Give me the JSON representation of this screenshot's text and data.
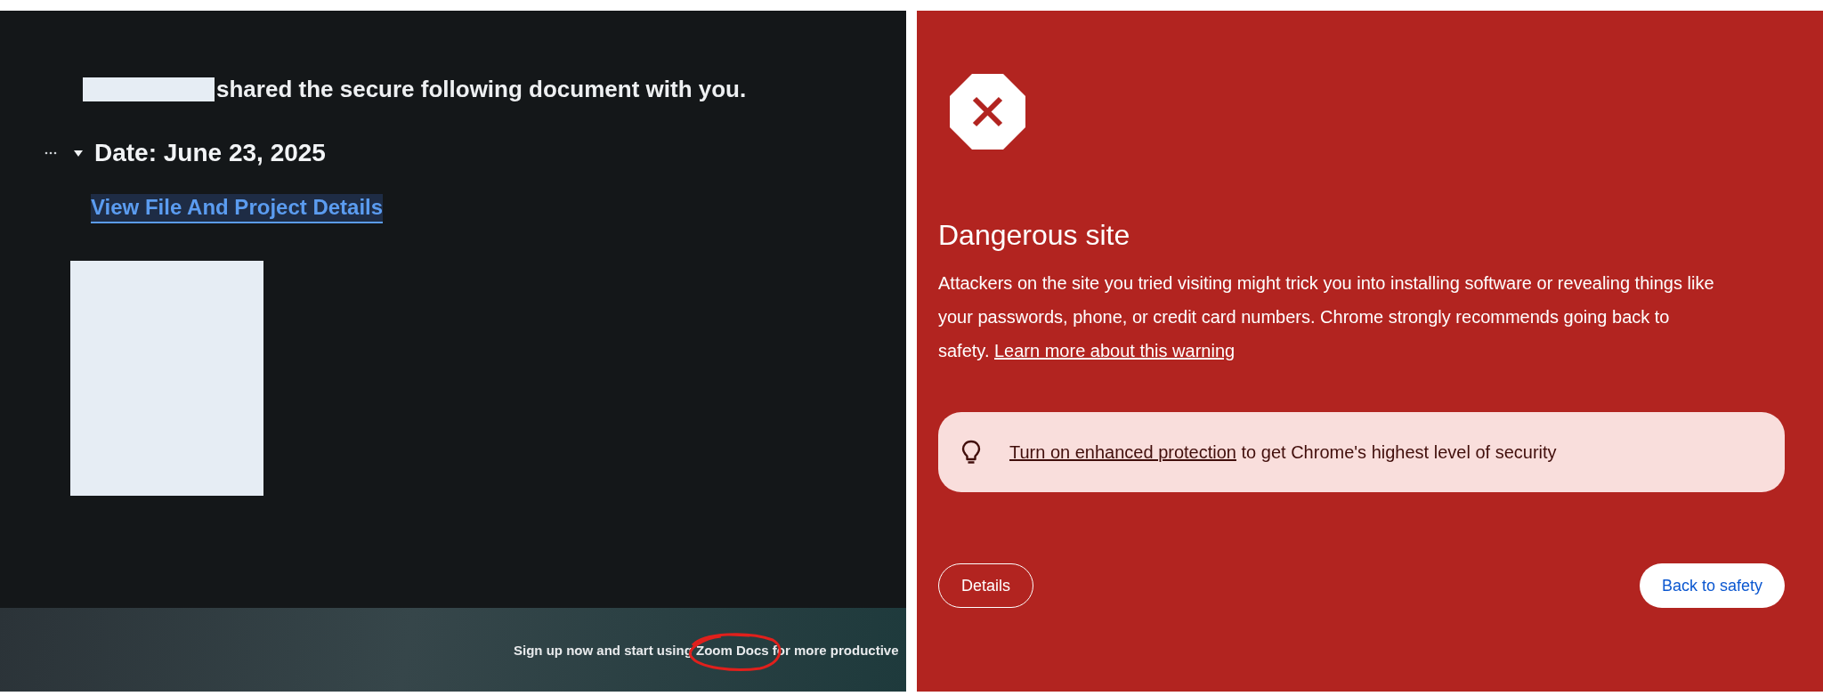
{
  "left": {
    "share_message": "shared the secure following document with you.",
    "section": {
      "title": "Date: June 23, 2025",
      "expanded": true,
      "link": "View File And Project Details"
    },
    "banner": {
      "text": "Sign up now and start using Zoom Docs for more productive"
    }
  },
  "right": {
    "title": "Dangerous site",
    "description": "Attackers on the site you tried visiting might trick you into installing software or revealing things like your passwords, phone, or credit card numbers. Chrome strongly recommends going back to safety. ",
    "learn_more_link": "Learn more about this warning",
    "tip": {
      "link": "Turn on enhanced protection",
      "text": " to get Chrome's highest level of security"
    },
    "buttons": [
      {
        "label": "Details",
        "kind": "outlined"
      },
      {
        "label": "Back to safety",
        "kind": "filled"
      }
    ]
  }
}
